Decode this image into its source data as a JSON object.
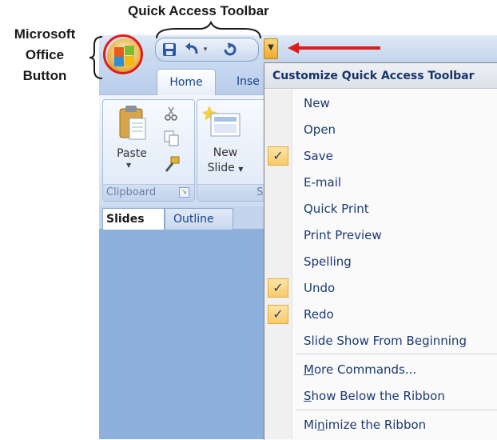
{
  "annotations": {
    "quick_access_toolbar": "Quick Access Toolbar",
    "office_button": [
      "Microsoft",
      "Office",
      "Button"
    ]
  },
  "ribbon": {
    "tabs": [
      {
        "label": "Home"
      },
      {
        "label": "Inse"
      }
    ],
    "groups": [
      {
        "label": "Clipboard"
      },
      {
        "label": "Sl"
      }
    ],
    "paste_label": "Paste",
    "new_slide_label": [
      "New",
      "Slide"
    ]
  },
  "pane_tabs": {
    "slides": "Slides",
    "outline": "Outline"
  },
  "menu": {
    "header": "Customize Quick Access Toolbar",
    "items": [
      {
        "label": "New",
        "checked": false
      },
      {
        "label": "Open",
        "checked": false
      },
      {
        "label": "Save",
        "checked": true
      },
      {
        "label": "E-mail",
        "checked": false
      },
      {
        "label": "Quick Print",
        "checked": false
      },
      {
        "label": "Print Preview",
        "checked": false
      },
      {
        "label": "Spelling",
        "checked": false
      },
      {
        "label": "Undo",
        "checked": true
      },
      {
        "label": "Redo",
        "checked": true
      },
      {
        "label": "Slide Show From Beginning",
        "checked": false
      }
    ],
    "more_commands": {
      "pre": "",
      "u": "M",
      "post": "ore Commands..."
    },
    "show_below": {
      "pre": "",
      "u": "S",
      "post": "how Below the Ribbon"
    },
    "minimize": {
      "pre": "Mi",
      "u": "n",
      "post": "imize the Ribbon"
    }
  },
  "colors": {
    "accent_red": "#e01b1b",
    "check_highlight": "#f9c96a",
    "menu_text": "#1b3a70"
  },
  "icons": [
    "save-icon",
    "undo-icon",
    "redo-icon",
    "dropdown-arrow-icon",
    "office-logo-icon",
    "paste-icon",
    "cut-icon",
    "copy-icon",
    "format-painter-icon",
    "new-slide-icon",
    "checkmark-icon"
  ]
}
